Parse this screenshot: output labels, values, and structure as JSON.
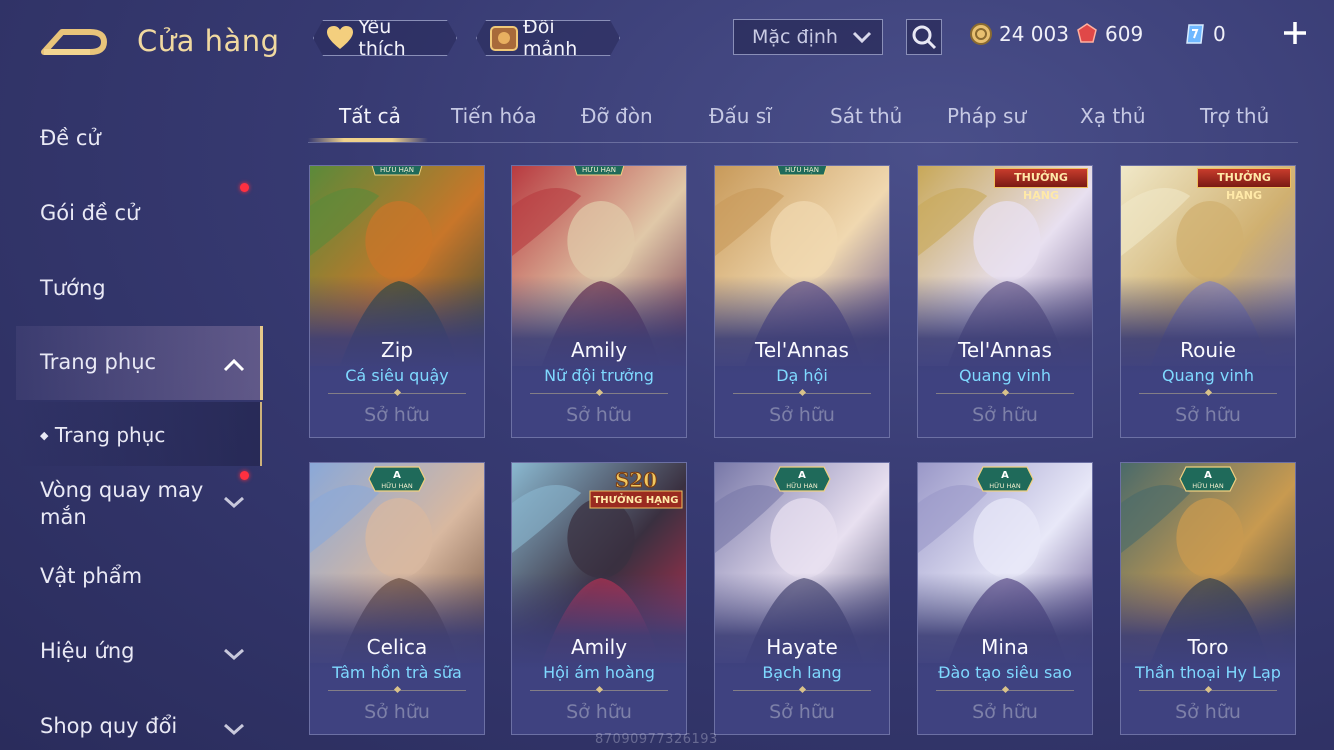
{
  "header": {
    "title": "Cửa hàng",
    "favorite_label": "Yêu thích",
    "shard_label": "Đổi mảnh",
    "sort_selected": "Mặc định",
    "currencies": [
      {
        "name": "gold",
        "value": "24 003",
        "color": "#e8c070"
      },
      {
        "name": "ruby",
        "value": "609",
        "color": "#e04848"
      },
      {
        "name": "voucher",
        "value": "0",
        "color": "#6fb8ff"
      }
    ]
  },
  "sidebar": {
    "items": [
      {
        "label": "Đề cử"
      },
      {
        "label": "Gói đề cử"
      },
      {
        "label": "Tướng"
      },
      {
        "label": "Trang phục"
      },
      {
        "label": "Trang phục"
      },
      {
        "label": "Vòng quay may mắn"
      },
      {
        "label": "Vật phẩm"
      },
      {
        "label": "Hiệu ứng"
      },
      {
        "label": "Shop quy đổi"
      }
    ]
  },
  "tabs": [
    "Tất cả",
    "Tiến hóa",
    "Đỡ đòn",
    "Đấu sĩ",
    "Sát thủ",
    "Pháp sư",
    "Xạ thủ",
    "Trợ thủ"
  ],
  "cards": [
    {
      "hero": "Zip",
      "skin": "Cá siêu quậy",
      "status": "Sở hữu",
      "badge": "HỮU HẠN",
      "art": [
        "#5a8a3a",
        "#c8762a",
        "#2c4a3a"
      ]
    },
    {
      "hero": "Amily",
      "skin": "Nữ đội trưởng",
      "status": "Sở hữu",
      "badge": "HỮU HẠN",
      "art": [
        "#b83a40",
        "#e0c8a8",
        "#6a2a48"
      ]
    },
    {
      "hero": "Tel'Annas",
      "skin": "Dạ hội",
      "status": "Sở hữu",
      "badge": "HỮU HẠN",
      "art": [
        "#c89a5a",
        "#f0d8b0",
        "#5a4a8a"
      ]
    },
    {
      "hero": "Tel'Annas",
      "skin": "Quang vinh",
      "status": "Sở hữu",
      "badge": "THƯỞNG HẠNG",
      "art": [
        "#c8a858",
        "#e8e0f0",
        "#6a5a8a"
      ]
    },
    {
      "hero": "Rouie",
      "skin": "Quang vinh",
      "status": "Sở hữu",
      "badge": "THƯỞNG HẠNG",
      "art": [
        "#f0e8c8",
        "#d0b070",
        "#8a88c0"
      ]
    },
    {
      "hero": "Celica",
      "skin": "Tâm hồn trà sữa",
      "status": "Sở hữu",
      "badge": "A HỮU HẠN",
      "art": [
        "#8aa8d8",
        "#d8b8a0",
        "#6a4a38"
      ]
    },
    {
      "hero": "Amily",
      "skin": "Hội ám hoàng",
      "status": "Sở hữu",
      "badge": "S20 THƯỞNG HẠNG",
      "art": [
        "#8ab8d0",
        "#3a3040",
        "#c03050"
      ]
    },
    {
      "hero": "Hayate",
      "skin": "Bạch lang",
      "status": "Sở hữu",
      "badge": "A HỮU HẠN",
      "art": [
        "#7878a8",
        "#e8e0f0",
        "#4a4870"
      ]
    },
    {
      "hero": "Mina",
      "skin": "Đào tạo siêu sao",
      "status": "Sở hữu",
      "badge": "A HỮU HẠN",
      "art": [
        "#9a98c8",
        "#e8e8f8",
        "#5a4a88"
      ]
    },
    {
      "hero": "Toro",
      "skin": "Thần thoại Hy Lạp",
      "status": "Sở hữu",
      "badge": "A HỮU HẠN",
      "art": [
        "#4a6a6a",
        "#c89a50",
        "#2a3a48"
      ]
    }
  ],
  "watermark": "87090977326193"
}
